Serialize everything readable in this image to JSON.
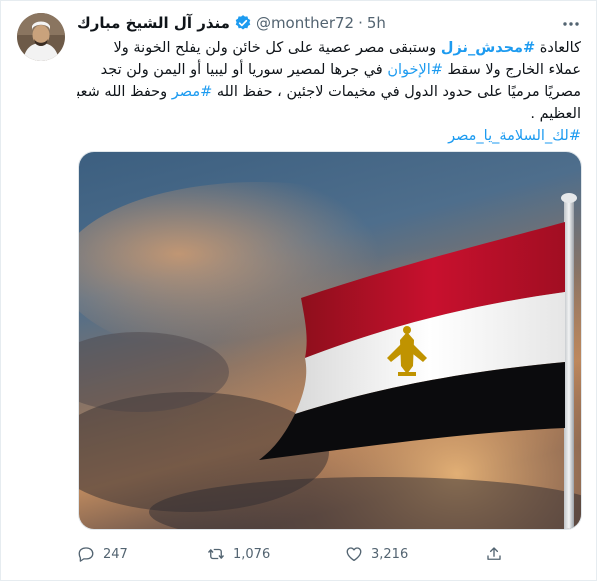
{
  "author": {
    "name": "منذر آل الشيخ مبارك",
    "handle": "@monther72",
    "separator": "·",
    "time": "5h"
  },
  "tweet": {
    "lines": [
      [
        {
          "text": "كالعادة ",
          "type": "text"
        },
        {
          "text": "#محدش_نزل",
          "type": "hashtag_bold"
        },
        {
          "text": " وستبقى مصر عصية على كل خائن ولن يفلح الخونة ولا",
          "type": "text"
        }
      ],
      [
        {
          "text": "عملاء الخارج ولا سقط ",
          "type": "text"
        },
        {
          "text": "#الإخوان",
          "type": "hashtag"
        },
        {
          "text": " في جرها لمصير سوريا أو ليبيا أو اليمن ولن تجد",
          "type": "text"
        }
      ],
      [
        {
          "text": "مصريًا مرميًا على حدود الدول في مخيمات لاجئين ، حفظ الله ",
          "type": "text"
        },
        {
          "text": "#مصر",
          "type": "hashtag"
        },
        {
          "text": " وحفظ الله شعبها",
          "type": "text"
        }
      ],
      [
        {
          "text": "العظيم .",
          "type": "text"
        }
      ],
      [
        {
          "text": "#لك_السلامة_يا_مصر",
          "type": "hashtag"
        }
      ]
    ]
  },
  "media": {
    "subject": "Egyptian flag on a pole against a sunset sky",
    "flag_colors": {
      "red": "#c8102e",
      "white": "#ffffff",
      "black": "#000000",
      "eagle": "#c09300"
    }
  },
  "actions": {
    "replies": "247",
    "retweets": "1,076",
    "likes": "3,216"
  },
  "colors": {
    "accent": "#1d9bf0",
    "secondary_text": "#536471",
    "primary_text": "#0f1419"
  }
}
